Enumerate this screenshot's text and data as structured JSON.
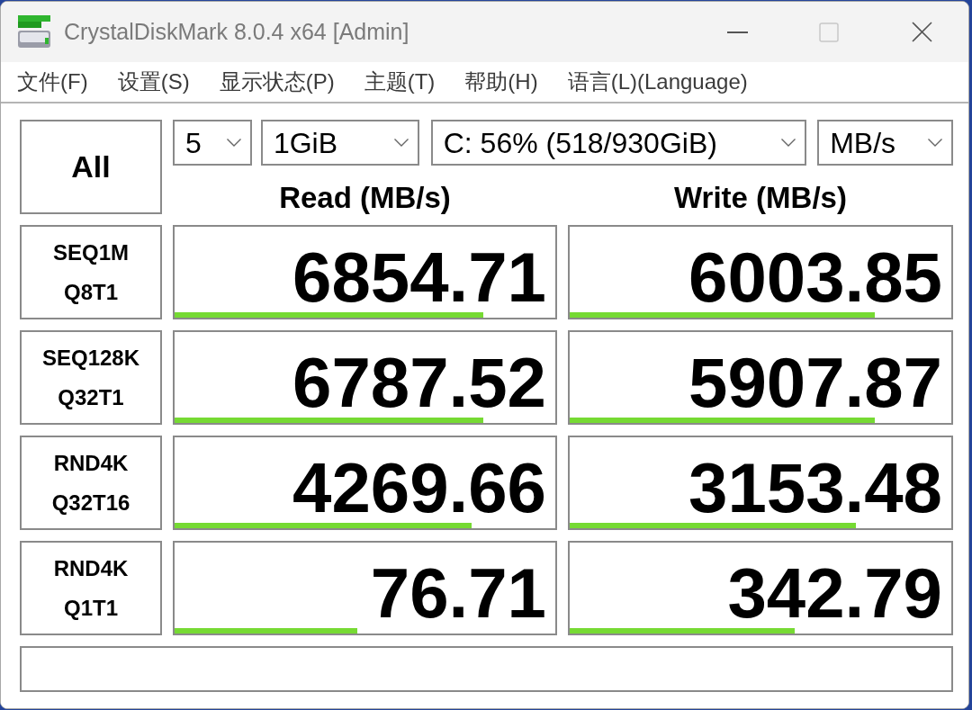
{
  "window": {
    "title": "CrystalDiskMark 8.0.4 x64 [Admin]",
    "maximize_disabled": true
  },
  "menu": [
    "文件(F)",
    "设置(S)",
    "显示状态(P)",
    "主题(T)",
    "帮助(H)",
    "语言(L)(Language)"
  ],
  "toolbar": {
    "all_button": "All",
    "dropdowns": [
      {
        "value": "5"
      },
      {
        "value": "1GiB"
      },
      {
        "value": "C: 56% (518/930GiB)"
      },
      {
        "value": "MB/s"
      }
    ]
  },
  "columns": [
    "Read (MB/s)",
    "Write (MB/s)"
  ],
  "tests": [
    {
      "lines": [
        "SEQ1M",
        "Q8T1"
      ],
      "results": [
        {
          "value": "6854.71",
          "level": 0.81
        },
        {
          "value": "6003.85",
          "level": 0.8
        }
      ]
    },
    {
      "lines": [
        "SEQ128K",
        "Q32T1"
      ],
      "results": [
        {
          "value": "6787.52",
          "level": 0.81
        },
        {
          "value": "5907.87",
          "level": 0.8
        }
      ]
    },
    {
      "lines": [
        "RND4K",
        "Q32T16"
      ],
      "results": [
        {
          "value": "4269.66",
          "level": 0.78
        },
        {
          "value": "3153.48",
          "level": 0.75
        }
      ]
    },
    {
      "lines": [
        "RND4K",
        "Q1T1"
      ],
      "results": [
        {
          "value": "76.71",
          "level": 0.48
        },
        {
          "value": "342.79",
          "level": 0.59
        }
      ]
    }
  ]
}
